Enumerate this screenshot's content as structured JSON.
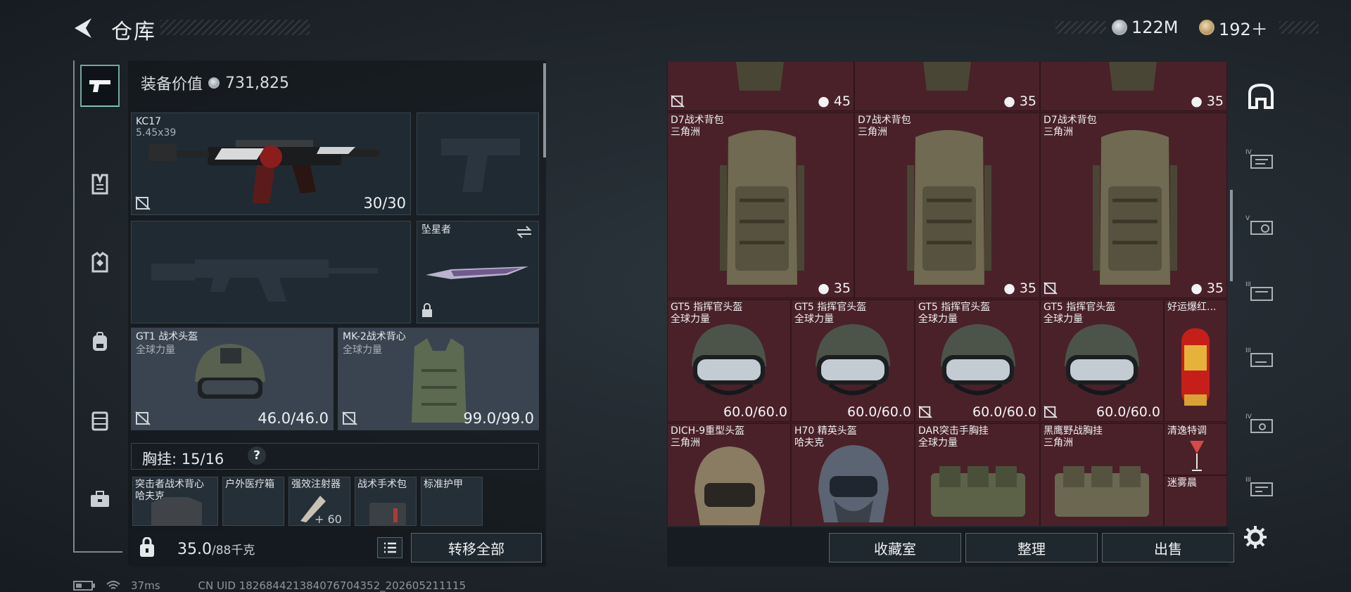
{
  "header": {
    "title": "仓库",
    "currency_silver": "122M",
    "currency_gold": "192＋"
  },
  "loadout": {
    "value_label": "装备价值",
    "value": "731,825",
    "primary": {
      "name": "KC17",
      "caliber": "5.45x39",
      "ammo": "30/30"
    },
    "melee": {
      "name": "坠星者"
    },
    "helmet": {
      "name": "GT1 战术头盔",
      "origin": "全球力量",
      "durability": "46.0/46.0"
    },
    "armor": {
      "name": "MK-2战术背心",
      "origin": "全球力量",
      "durability": "99.0/99.0"
    },
    "chest_label": "胸挂:",
    "chest_count": "15/16",
    "chest_help": "?",
    "chest_items": [
      {
        "name": "突击者战术背心",
        "origin": "哈夫克"
      },
      {
        "name": "户外医疗箱",
        "origin": ""
      },
      {
        "name": "强效注射器",
        "value": "60"
      },
      {
        "name": "战术手术包",
        "origin": ""
      },
      {
        "name": "标准护甲",
        "origin": ""
      }
    ],
    "weight": "35.0",
    "weight_max": "/88千克",
    "transfer_all": "转移全部"
  },
  "grid": {
    "row1": [
      {
        "value": "45"
      },
      {
        "value": "35"
      },
      {
        "value": "35"
      }
    ],
    "row2": [
      {
        "name": "D7战术背包",
        "origin": "三角洲",
        "value": "35"
      },
      {
        "name": "D7战术背包",
        "origin": "三角洲",
        "value": "35"
      },
      {
        "name": "D7战术背包",
        "origin": "三角洲",
        "value": "35"
      }
    ],
    "row3": [
      {
        "name": "GT5 指挥官头盔",
        "origin": "全球力量",
        "value": "60.0/60.0"
      },
      {
        "name": "GT5 指挥官头盔",
        "origin": "全球力量",
        "value": "60.0/60.0"
      },
      {
        "name": "GT5 指挥官头盔",
        "origin": "全球力量",
        "value": "60.0/60.0"
      },
      {
        "name": "GT5 指挥官头盔",
        "origin": "全球力量",
        "value": "60.0/60.0"
      },
      {
        "name": "好运爆红..."
      }
    ],
    "row4": [
      {
        "name": "DICH-9重型头盔",
        "origin": "三角洲"
      },
      {
        "name": "H70 精英头盔",
        "origin": "哈夫克"
      },
      {
        "name": "DAR突击手胸挂",
        "origin": "全球力量"
      },
      {
        "name": "黑鹰野战胸挂",
        "origin": "三角洲"
      },
      {
        "name": "清逸特调",
        "name2": "迷雾晨"
      }
    ]
  },
  "actions": {
    "collection": "收藏室",
    "organize": "整理",
    "sell": "出售"
  },
  "status": {
    "ping": "37ms",
    "uid": "CN UID 18268442138407670435​2_202605211115"
  },
  "colors": {
    "grid_bg": "#4a2129",
    "accent": "#78c6b2"
  }
}
